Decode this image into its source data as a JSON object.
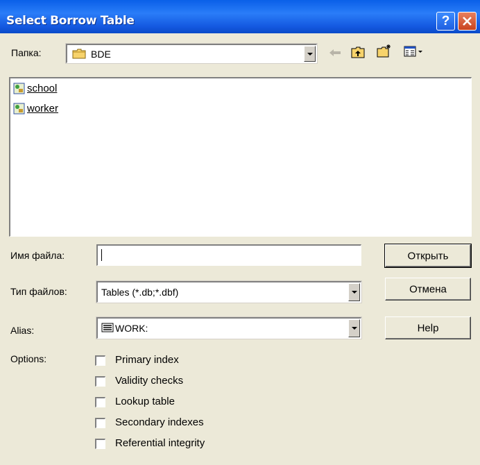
{
  "window": {
    "title": "Select Borrow Table"
  },
  "folder": {
    "label": "Папка:",
    "value": "BDE"
  },
  "files": [
    {
      "name": "school"
    },
    {
      "name": "worker"
    }
  ],
  "filename": {
    "label": "Имя файла:",
    "value": ""
  },
  "filetype": {
    "label": "Тип файлов:",
    "value": "Tables (*.db;*.dbf)"
  },
  "alias": {
    "label": "Alias:",
    "value": "WORK:"
  },
  "options": {
    "label": "Options:",
    "items": [
      {
        "label": "Primary index",
        "checked": false
      },
      {
        "label": "Validity checks",
        "checked": false
      },
      {
        "label": "Lookup table",
        "checked": false
      },
      {
        "label": "Secondary indexes",
        "checked": false
      },
      {
        "label": "Referential integrity",
        "checked": false
      }
    ]
  },
  "buttons": {
    "open": "Открыть",
    "cancel": "Отмена",
    "help": "Help"
  },
  "icons": {
    "help": "help-icon",
    "close": "close-icon",
    "folder": "folder-icon",
    "back": "back-arrow-icon",
    "up": "up-folder-icon",
    "new_folder": "new-folder-icon",
    "view": "view-menu-icon",
    "table": "table-file-icon",
    "alias": "database-alias-icon"
  },
  "colors": {
    "titlebar": "#0A5FE8",
    "close": "#C9431F",
    "dialog_bg": "#ECE9D8"
  }
}
